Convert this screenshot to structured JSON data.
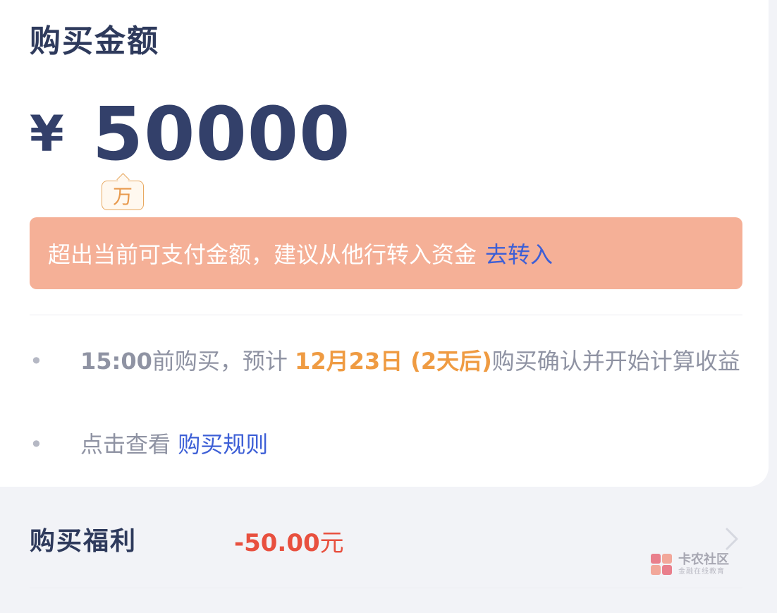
{
  "header": {
    "title": "购买金额"
  },
  "amount": {
    "currency": "¥",
    "value": "50000",
    "unit": "万"
  },
  "alert": {
    "message": "超出当前可支付金额，建议从他行转入资金",
    "action": "去转入"
  },
  "notes": {
    "n1": {
      "time": "15:00",
      "t1": "前购买，预计",
      "date": "12月23日 (2天后)",
      "t2": "购买确认并开始计算收益"
    },
    "n2": {
      "t1": "点击查看",
      "link": "购买规则"
    }
  },
  "benefit": {
    "label": "购买福利",
    "amount": "-50.00",
    "yuan": "元"
  },
  "watermark": {
    "main": "卡农社区",
    "sub": "金融在线教育"
  },
  "colors": {
    "title": "#2e3a5c",
    "accent_blue": "#3d5fd6",
    "alert_bg": "#f5b097",
    "orange": "#ef9b42",
    "red": "#e8503f"
  }
}
